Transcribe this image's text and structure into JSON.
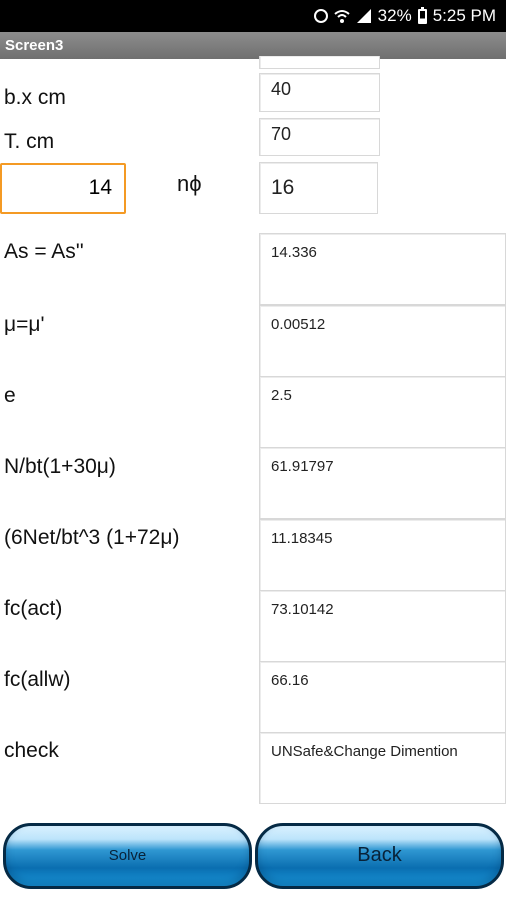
{
  "status_bar": {
    "battery": "32%",
    "time": "5:25 PM",
    "icons": [
      "alarm-icon",
      "wifi-icon",
      "signal-icon",
      "battery-icon"
    ]
  },
  "title": "Screen3",
  "inputs": {
    "bx_label": "b.x cm",
    "bx_value": "40",
    "t_label": "T. cm",
    "t_value": "70",
    "left_value": "14",
    "nphi_label": "nϕ",
    "nphi_value": "16"
  },
  "results": [
    {
      "label": "As = As''",
      "value": "14.336"
    },
    {
      "label": "μ=μ'",
      "value": "0.00512"
    },
    {
      "label": "e",
      "value": "2.5"
    },
    {
      "label": "N/bt(1+30μ)",
      "value": "61.91797"
    },
    {
      "label": "(6Net/bt^3 (1+72μ)",
      "value": "11.18345"
    },
    {
      "label": "fc(act)",
      "value": "73.10142"
    },
    {
      "label": "fc(allw)",
      "value": "66.16"
    },
    {
      "label": "check",
      "value": "UNSafe&Change Dimention"
    }
  ],
  "buttons": {
    "solve": "Solve",
    "back": "Back"
  },
  "colors": {
    "title_bar": "#7d7d7d",
    "focus_border": "#f49a24",
    "button_blue": "#1a8fd0"
  }
}
